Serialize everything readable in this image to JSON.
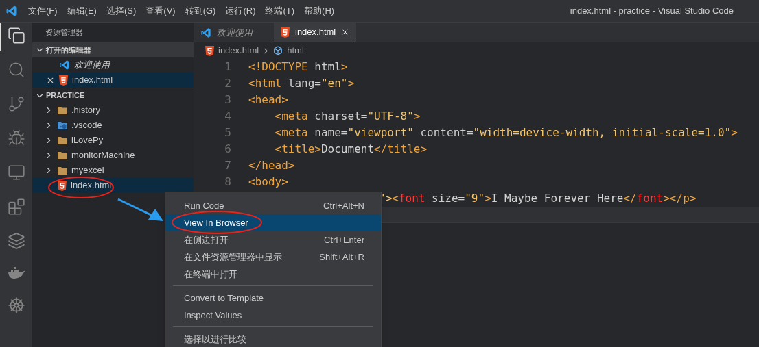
{
  "window": {
    "title": "index.html - practice - Visual Studio Code"
  },
  "menu_bar": [
    "文件(F)",
    "编辑(E)",
    "选择(S)",
    "查看(V)",
    "转到(G)",
    "运行(R)",
    "终端(T)",
    "帮助(H)"
  ],
  "sidebar": {
    "title": "资源管理器",
    "open_editors": {
      "title": "打开的编辑器",
      "expanded": true,
      "items": [
        {
          "label": "欢迎使用",
          "kind": "welcome",
          "preview": true,
          "selected": false
        },
        {
          "label": "index.html",
          "kind": "html",
          "preview": false,
          "selected": true
        }
      ]
    },
    "workspace": {
      "title": "PRACTICE",
      "expanded": true,
      "items": [
        {
          "label": ".history",
          "kind": "folder",
          "expanded": false,
          "selected": false
        },
        {
          "label": ".vscode",
          "kind": "vscode-folder",
          "expanded": false,
          "selected": false
        },
        {
          "label": "iLovePy",
          "kind": "folder",
          "expanded": false,
          "selected": false
        },
        {
          "label": "monitorMachine",
          "kind": "folder",
          "expanded": false,
          "selected": false
        },
        {
          "label": "myexcel",
          "kind": "folder",
          "expanded": false,
          "selected": false
        },
        {
          "label": "index.html",
          "kind": "html",
          "selected": true
        }
      ]
    }
  },
  "tabs": [
    {
      "label": "欢迎使用",
      "kind": "welcome",
      "preview": true,
      "selected": false
    },
    {
      "label": "index.html",
      "kind": "html",
      "preview": false,
      "selected": true
    }
  ],
  "breadcrumb": [
    {
      "label": "index.html",
      "kind": "html"
    },
    {
      "label": "html",
      "kind": "element"
    }
  ],
  "code_lines": [
    {
      "number": "1",
      "tokens": [
        {
          "text": "<!DOCTYPE",
          "kind": "tag"
        },
        {
          "text": " html",
          "kind": "attr"
        },
        {
          "text": ">",
          "kind": "tag"
        }
      ]
    },
    {
      "number": "2",
      "tokens": [
        {
          "text": "<html",
          "kind": "tag"
        },
        {
          "text": " lang=",
          "kind": "attr"
        },
        {
          "text": "\"en\"",
          "kind": "string"
        },
        {
          "text": ">",
          "kind": "tag"
        }
      ]
    },
    {
      "number": "3",
      "tokens": [
        {
          "text": "<head>",
          "kind": "tag"
        }
      ]
    },
    {
      "number": "4",
      "tokens": [
        {
          "text": "    <meta",
          "kind": "tag"
        },
        {
          "text": " charset=",
          "kind": "attr"
        },
        {
          "text": "\"UTF-8\"",
          "kind": "string"
        },
        {
          "text": ">",
          "kind": "tag"
        }
      ]
    },
    {
      "number": "5",
      "tokens": [
        {
          "text": "    <meta",
          "kind": "tag"
        },
        {
          "text": " name=",
          "kind": "attr"
        },
        {
          "text": "\"viewport\"",
          "kind": "string"
        },
        {
          "text": " content=",
          "kind": "attr"
        },
        {
          "text": "\"width=device-width, initial-scale=1.0\"",
          "kind": "string"
        },
        {
          "text": ">",
          "kind": "tag"
        }
      ]
    },
    {
      "number": "6",
      "tokens": [
        {
          "text": "    <title>",
          "kind": "tag"
        },
        {
          "text": "Document",
          "kind": "text"
        },
        {
          "text": "</title>",
          "kind": "tag"
        }
      ]
    },
    {
      "number": "7",
      "tokens": [
        {
          "text": "</head>",
          "kind": "tag"
        }
      ]
    },
    {
      "number": "8",
      "tokens": [
        {
          "text": "<body>",
          "kind": "tag"
        }
      ]
    },
    {
      "clipped": true,
      "tokens": [
        {
          "text": "\">",
          "kind": "string"
        },
        {
          "text": "<",
          "kind": "tag"
        },
        {
          "text": "font",
          "kind": "deprecated"
        },
        {
          "text": " size=",
          "kind": "attr"
        },
        {
          "text": "\"9\"",
          "kind": "string"
        },
        {
          "text": ">",
          "kind": "tag"
        },
        {
          "text": "I Maybe Forever Here",
          "kind": "text"
        },
        {
          "text": "</",
          "kind": "tag"
        },
        {
          "text": "font",
          "kind": "deprecated"
        },
        {
          "text": "></p>",
          "kind": "tag"
        }
      ]
    }
  ],
  "context_menu": {
    "groups": [
      [
        {
          "label": "Run Code",
          "shortcut": "Ctrl+Alt+N",
          "selected": false
        },
        {
          "label": "View In Browser",
          "selected": true
        },
        {
          "label": "在侧边打开",
          "shortcut": "Ctrl+Enter",
          "selected": false
        },
        {
          "label": "在文件资源管理器中显示",
          "shortcut": "Shift+Alt+R",
          "selected": false
        },
        {
          "label": "在终端中打开",
          "selected": false
        }
      ],
      [
        {
          "label": "Convert to Template",
          "selected": false
        },
        {
          "label": "Inspect Values",
          "selected": false
        }
      ],
      [
        {
          "label": "选择以进行比较",
          "selected": false
        }
      ]
    ]
  }
}
